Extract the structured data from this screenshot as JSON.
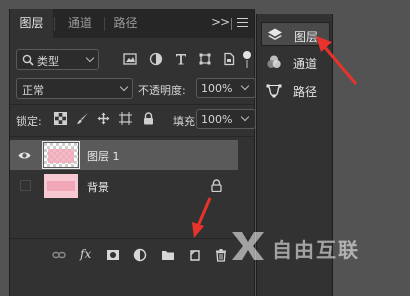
{
  "layers_panel": {
    "tabs": [
      {
        "label": "图层",
        "active": true
      },
      {
        "label": "通道",
        "active": false
      },
      {
        "label": "路径",
        "active": false
      }
    ],
    "expand_icon": ">>",
    "filter": {
      "label": "类型"
    },
    "blend_mode": "正常",
    "opacity_label": "不透明度:",
    "opacity_value": "100%",
    "lock_label": "锁定:",
    "fill_label": "填充:",
    "fill_value": "100%",
    "layers": [
      {
        "name": "图层 1",
        "visible": true,
        "selected": true
      },
      {
        "name": "背景",
        "visible": false,
        "locked": true
      }
    ],
    "bottom_icons": [
      "link-icon",
      "fx-icon",
      "mask-icon",
      "adjustment-icon",
      "group-folder-icon",
      "new-layer-icon",
      "trash-icon"
    ],
    "fx_label": "fx"
  },
  "right_panel": {
    "items": [
      {
        "label": "图层",
        "icon": "layers-icon",
        "active": true
      },
      {
        "label": "通道",
        "icon": "channels-icon",
        "active": false
      },
      {
        "label": "路径",
        "icon": "paths-icon",
        "active": false
      }
    ]
  },
  "watermark": {
    "text": "自由互联"
  },
  "colors": {
    "panel_bg": "#323232",
    "tab_bar_bg": "#262626",
    "selected_layer": "#5a5a5a",
    "annotation_red": "#e8322c",
    "canvas_pink": "#f2a7b8"
  }
}
